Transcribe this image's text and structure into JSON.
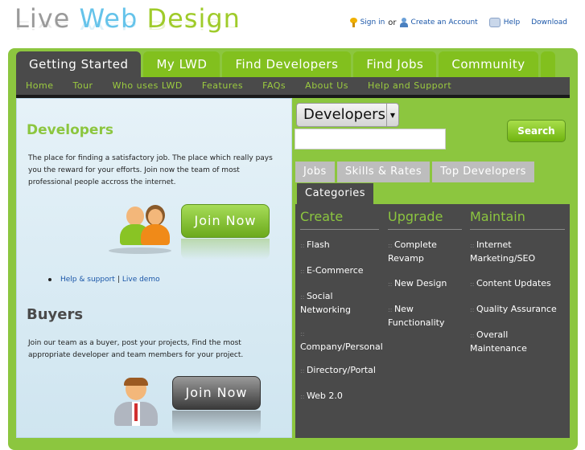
{
  "header": {
    "logo": {
      "w1": "Live",
      "w2": "Web",
      "w3": "Design"
    },
    "toplinks": {
      "sign_in": "Sign in",
      "or": "or",
      "create_account": "Create an Account",
      "help": "Help",
      "download": "Download"
    }
  },
  "tabs": [
    {
      "label": "Getting Started",
      "active": true
    },
    {
      "label": "My LWD",
      "active": false
    },
    {
      "label": "Find Developers",
      "active": false
    },
    {
      "label": "Find Jobs",
      "active": false
    },
    {
      "label": "Community",
      "active": false
    }
  ],
  "subnav": [
    "Home",
    "Tour",
    "Who uses LWD",
    "Features",
    "FAQs",
    "About Us",
    "Help and Support"
  ],
  "left": {
    "developers_title": "Developers",
    "developers_text": "The place for finding a satisfactory job. The place which really pays you the reward for your efforts. Join now the team of most professional people accross the internet.",
    "join_label": "Join Now",
    "help_link": "Help & support",
    "demo_link": "Live demo",
    "buyers_title": "Buyers",
    "buyers_text": "Join our team as a buyer, post your projects, Find the most appropriate developer and team members for your project.",
    "join_label_2": "Join Now"
  },
  "right": {
    "select_value": "Developers",
    "search_label": "Search",
    "search_value": "",
    "cat_tabs": [
      "Jobs",
      "Skills & Rates",
      "Top Developers"
    ],
    "cat_active": "Categories",
    "columns": [
      {
        "title": "Create",
        "items": [
          "Flash",
          "E-Commerce",
          "Social Networking",
          "Company/Personal",
          "Directory/Portal",
          "Web 2.0"
        ]
      },
      {
        "title": "Upgrade",
        "items": [
          "Complete Revamp",
          "New Design",
          "New Functionality"
        ]
      },
      {
        "title": "Maintain",
        "items": [
          "Internet Marketing/SEO",
          "Content Updates",
          "Quality Assurance",
          "Overall Maintenance"
        ]
      }
    ]
  },
  "colors": {
    "green": "#8cc63f",
    "dark": "#4a4a4a",
    "blue": "#65c3ea"
  }
}
